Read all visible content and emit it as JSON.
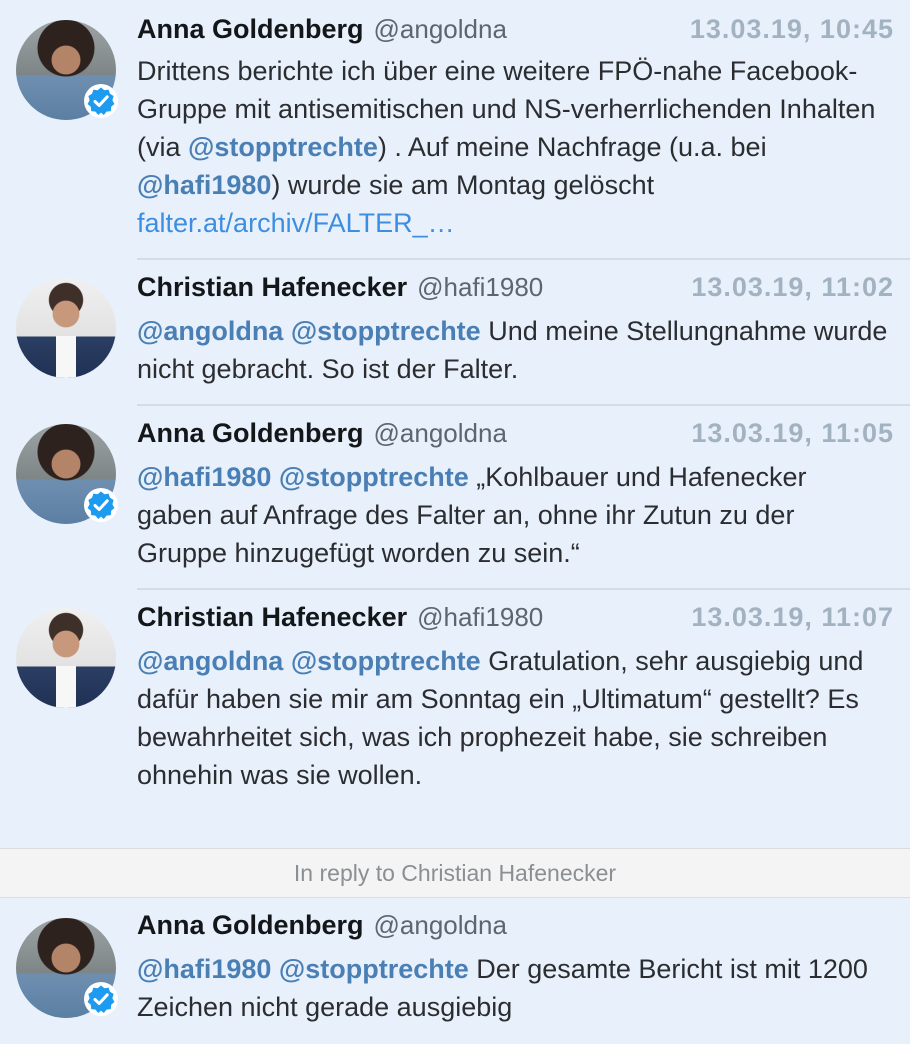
{
  "tweets": [
    {
      "name": "Anna Goldenberg",
      "handle": "@angoldna",
      "time": "13.03.19, 10:45",
      "verified": true,
      "body": {
        "t1": "Drittens berichte ich über eine weitere FPÖ-nahe Facebook-Gruppe mit antisemitischen und NS-verherrlichenden Inhalten (via ",
        "m1": "@stopptrechte",
        "t2": ") . Auf meine Nachfrage (u.a. bei ",
        "m2": "@hafi1980",
        "t3": ") wurde sie am Montag gelöscht ",
        "link": "falter.at/archiv/FALTER_…"
      }
    },
    {
      "name": "Christian Hafenecker",
      "handle": "@hafi1980",
      "time": "13.03.19, 11:02",
      "verified": false,
      "body": {
        "m1": "@angoldna",
        "m2": "@stopptrechte",
        "t1": " Und meine Stellungnahme wurde nicht gebracht. So ist der Falter."
      }
    },
    {
      "name": "Anna Goldenberg",
      "handle": "@angoldna",
      "time": "13.03.19, 11:05",
      "verified": true,
      "body": {
        "m1": "@hafi1980",
        "m2": "@stopptrechte",
        "t1": " „Kohlbauer und Hafenecker gaben auf Anfrage des Falter an, ohne ihr Zutun zu der Gruppe hinzugefügt worden zu sein.“"
      }
    },
    {
      "name": "Christian Hafenecker",
      "handle": "@hafi1980",
      "time": "13.03.19, 11:07",
      "verified": false,
      "body": {
        "m1": "@angoldna",
        "m2": "@stopptrechte",
        "t1": " Gratulation, sehr ausgiebig und dafür haben sie mir am Sonntag ein „Ultimatum“ gestellt? Es bewahrheitet sich, was ich prophezeit habe, sie schreiben ohnehin was sie wollen."
      }
    }
  ],
  "reply_context": "In reply to Christian Hafenecker",
  "reply_tweet": {
    "name": "Anna Goldenberg",
    "handle": "@angoldna",
    "verified": true,
    "body": {
      "m1": "@hafi1980",
      "m2": "@stopptrechte",
      "t1": " Der gesamte Bericht ist mit 1200 Zeichen nicht gerade ausgiebig"
    }
  },
  "colors": {
    "background": "#e8f1fb",
    "mention": "#4a7fb5",
    "link": "#3d8ee0",
    "timestamp": "#a3b2c0",
    "verified": "#1d9bf0"
  },
  "icons": {
    "verified": "verified-badge-icon"
  }
}
